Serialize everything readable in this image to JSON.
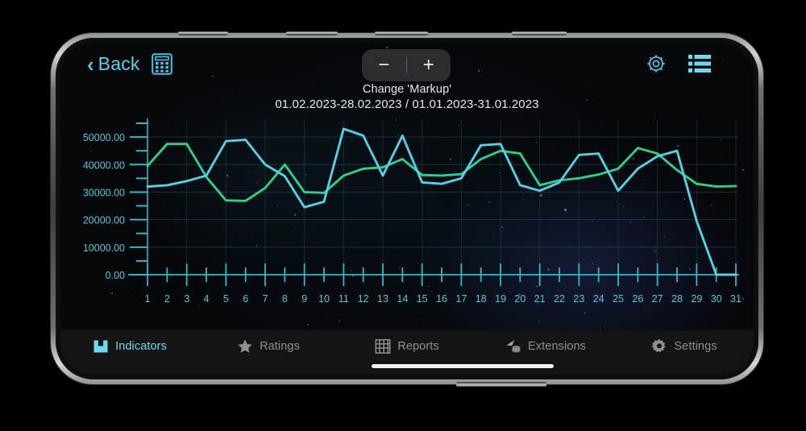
{
  "header": {
    "back_label": "Back",
    "back_chevron": "‹",
    "calculator_icon": "calculator-icon",
    "zoom_out_label": "−",
    "zoom_in_label": "+",
    "gear_icon": "gear-icon",
    "list_icon": "list-icon"
  },
  "chart_data": {
    "type": "line",
    "title": "Change 'Markup'",
    "subtitle": "01.02.2023-28.02.2023 / 01.01.2023-31.01.2023",
    "xlabel": "",
    "ylabel": "",
    "grid": true,
    "legend_position": "none",
    "x": [
      1,
      2,
      3,
      4,
      5,
      6,
      7,
      8,
      9,
      10,
      11,
      12,
      13,
      14,
      15,
      16,
      17,
      18,
      19,
      20,
      21,
      22,
      23,
      24,
      25,
      26,
      27,
      28,
      29,
      30,
      31
    ],
    "categories": [
      "1",
      "2",
      "3",
      "4",
      "5",
      "6",
      "7",
      "8",
      "9",
      "10",
      "11",
      "12",
      "13",
      "14",
      "15",
      "16",
      "17",
      "18",
      "19",
      "20",
      "21",
      "22",
      "23",
      "24",
      "25",
      "26",
      "27",
      "28",
      "29",
      "30",
      "31"
    ],
    "xlim": [
      1,
      31
    ],
    "ylim": [
      0,
      55000
    ],
    "ytick_labels": [
      "0.00",
      "10000.00",
      "20000.00",
      "30000.00",
      "40000.00",
      "50000.00"
    ],
    "ytick_values": [
      0,
      10000,
      20000,
      30000,
      40000,
      50000
    ],
    "yminor_step": 5000,
    "series": [
      {
        "name": "01.02.2023-28.02.2023",
        "color": "#2fcf8b",
        "values": [
          39500,
          47500,
          47500,
          35500,
          27000,
          26800,
          31500,
          40000,
          30000,
          29700,
          36000,
          38500,
          39000,
          42000,
          36200,
          36000,
          36500,
          42000,
          45000,
          44000,
          32500,
          34300,
          35000,
          36400,
          38500,
          46000,
          44000,
          38000,
          33000,
          32000,
          32200
        ]
      },
      {
        "name": "01.01.2023-31.01.2023",
        "color": "#57cfe3",
        "values": [
          32000,
          32500,
          34000,
          36000,
          48500,
          49000,
          40000,
          35800,
          24500,
          26500,
          53000,
          50500,
          36000,
          50500,
          33500,
          33000,
          35000,
          47000,
          47500,
          32500,
          30500,
          33500,
          43500,
          44000,
          30500,
          38500,
          43000,
          45000,
          19500,
          0,
          0
        ]
      }
    ]
  },
  "tabs": [
    {
      "label": "Indicators",
      "icon": "indicators-icon",
      "active": true
    },
    {
      "label": "Ratings",
      "icon": "star-icon",
      "active": false
    },
    {
      "label": "Reports",
      "icon": "grid-icon",
      "active": false
    },
    {
      "label": "Extensions",
      "icon": "extensions-icon",
      "active": false
    },
    {
      "label": "Settings",
      "icon": "gear-icon",
      "active": false
    }
  ],
  "colors": {
    "accent": "#5fd0ea",
    "series_green": "#2fcf8b",
    "series_cyan": "#57cfe3",
    "axis": "#35b8c9",
    "tab_inactive": "#8d9195",
    "screen_bg": "#05070a"
  }
}
